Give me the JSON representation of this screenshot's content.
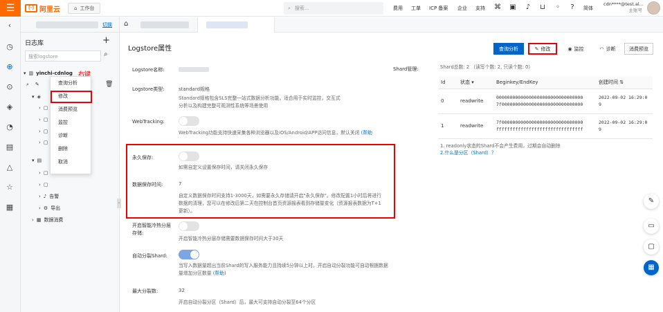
{
  "topbar": {
    "logo_text": "阿里云",
    "workbench_label": "工作台",
    "search_placeholder": "搜索...",
    "nav_links": [
      "费用",
      "工单",
      "ICP 备案",
      "企业",
      "支持"
    ],
    "lang": "简体",
    "user_name": "cdn****@test.al...",
    "user_role": "主账号"
  },
  "sidebar": {
    "switch_label": "切换",
    "title": "日志库",
    "search_placeholder": "搜索logstore",
    "project_name": "yinchi-cdnlog",
    "rightkey_label": "右键",
    "tree_items": [
      {
        "label": "告警"
      },
      {
        "label": "导出"
      },
      {
        "label": "数据消费"
      }
    ]
  },
  "context_menu": {
    "items": [
      "查询分析",
      "修改",
      "消费预览",
      "监控",
      "诊断",
      "删除",
      "取消"
    ],
    "highlighted": "修改"
  },
  "main": {
    "page_title": "Logstore属性",
    "buttons": {
      "query": "查询分析",
      "edit": "修改",
      "monitor": "监控",
      "diagnose": "诊断",
      "consume_preview": "消费预览"
    },
    "fields": {
      "name_label": "Logstore名称:",
      "type_label": "Logstore类型:",
      "type_value": "standard规格",
      "type_desc": "Standard规格包含SLS完整一站式数据分析功能，适合用于实时监控，交互式分析以及构建完整可观测性系统等场景使用",
      "webtracking_label": "WebTracking:",
      "webtracking_desc": "WebTracking功能支持快速采集各种浏览器以及iOS/Android/APP访问信息，默认关闭",
      "webtracking_help": "(帮助",
      "permanent_label": "永久保存:",
      "permanent_desc": "如需自定义设置保存时间，请关闭永久保存",
      "retention_label": "数据保存时间:",
      "retention_value": "7",
      "retention_desc": "自定义数据保存时间支持1-3000天，如需要永久存储请开启\"永久保存\"。修改配置1小时后将进行数据的清理，您可以在修改后第二天在控制台首页资源报表看到存储量变化（资源报表数据为T+1更新）。",
      "tiering_label": "开启智能冷热分层存储:",
      "tiering_desc": "开启智能冷热分层存储需要数据保存时间大于30天",
      "autosplit_label": "自动分裂Shard:",
      "autosplit_desc": "当写入数据量超出当前Shard的写入服务能力且持续5分钟以上时，开启自动分裂功能可自动根据数据量增加分区数量",
      "autosplit_help": "(帮助)",
      "maxsplit_label": "最大分裂数:",
      "maxsplit_value": "32",
      "maxsplit_desc": "开启自动分裂分区（Shard）后，最大可支持自动分裂至64个分区"
    },
    "shard": {
      "label": "Shard管理:",
      "summary": "Shard总数: 2 （读写个数: 2, 只读个数: 0）",
      "columns": [
        "Id",
        "状态",
        "Beginkey/EndKey",
        "创建时间"
      ],
      "rows": [
        {
          "id": "0",
          "status": "readwrite",
          "begin_key": "00000000000000000000000000000000",
          "end_key": "7f000000000000000000000000000000",
          "created": "2022-09-02 16:29:09"
        },
        {
          "id": "1",
          "status": "readwrite",
          "begin_key": "7f000000000000000000000000000000",
          "end_key": "ffffffffffffffffffffffffffffffff",
          "created": "2022-09-02 16:29:09"
        }
      ],
      "note1": "1. readonly状态的Shard不会产生费用，过期会自动删除",
      "note2": "2.什么是分区（Shard）？"
    }
  },
  "colors": {
    "brand_orange": "#ff6a00",
    "primary_blue": "#0064c8",
    "highlight_red": "#ee0000"
  }
}
